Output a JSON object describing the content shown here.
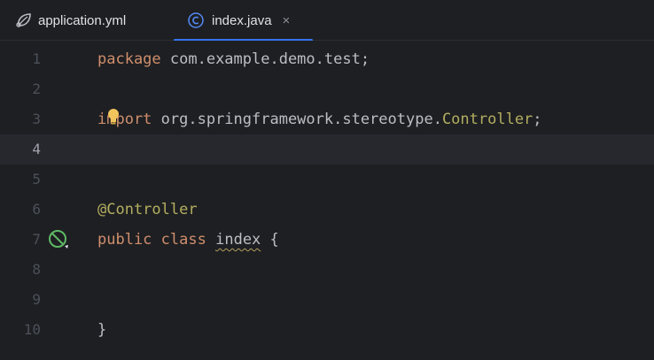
{
  "tabs": [
    {
      "label": "application.yml",
      "icon": "spring-leaf-icon",
      "active": false
    },
    {
      "label": "index.java",
      "icon": "java-class-icon",
      "active": true,
      "close": "×"
    }
  ],
  "editor": {
    "current_line": 4,
    "lines": [
      {
        "n": "1",
        "tokens": [
          {
            "t": "package",
            "c": "kw"
          },
          {
            "t": " com.example.demo.test;",
            "c": ""
          }
        ]
      },
      {
        "n": "2",
        "tokens": []
      },
      {
        "n": "3",
        "tokens": [
          {
            "t": "import",
            "c": "kw"
          },
          {
            "t": " org.springframework.stereotype.",
            "c": ""
          },
          {
            "t": "Controller",
            "c": "cls"
          },
          {
            "t": ";",
            "c": ""
          }
        ]
      },
      {
        "n": "4",
        "tokens": []
      },
      {
        "n": "5",
        "tokens": []
      },
      {
        "n": "6",
        "tokens": [
          {
            "t": "@Controller",
            "c": "ann"
          }
        ]
      },
      {
        "n": "7",
        "tokens": [
          {
            "t": "public",
            "c": "kw"
          },
          {
            "t": " ",
            "c": ""
          },
          {
            "t": "class",
            "c": "kw"
          },
          {
            "t": " ",
            "c": ""
          },
          {
            "t": "index",
            "c": "wavy"
          },
          {
            "t": " {",
            "c": ""
          }
        ]
      },
      {
        "n": "8",
        "tokens": []
      },
      {
        "n": "9",
        "tokens": []
      },
      {
        "n": "10",
        "tokens": [
          {
            "t": "}",
            "c": ""
          }
        ]
      }
    ]
  },
  "colors": {
    "accent": "#3574f0",
    "keyword": "#cf8e6d",
    "annotation": "#b3ae60",
    "gutter_icon": "#5fb865",
    "bulb": "#f2c55c"
  }
}
